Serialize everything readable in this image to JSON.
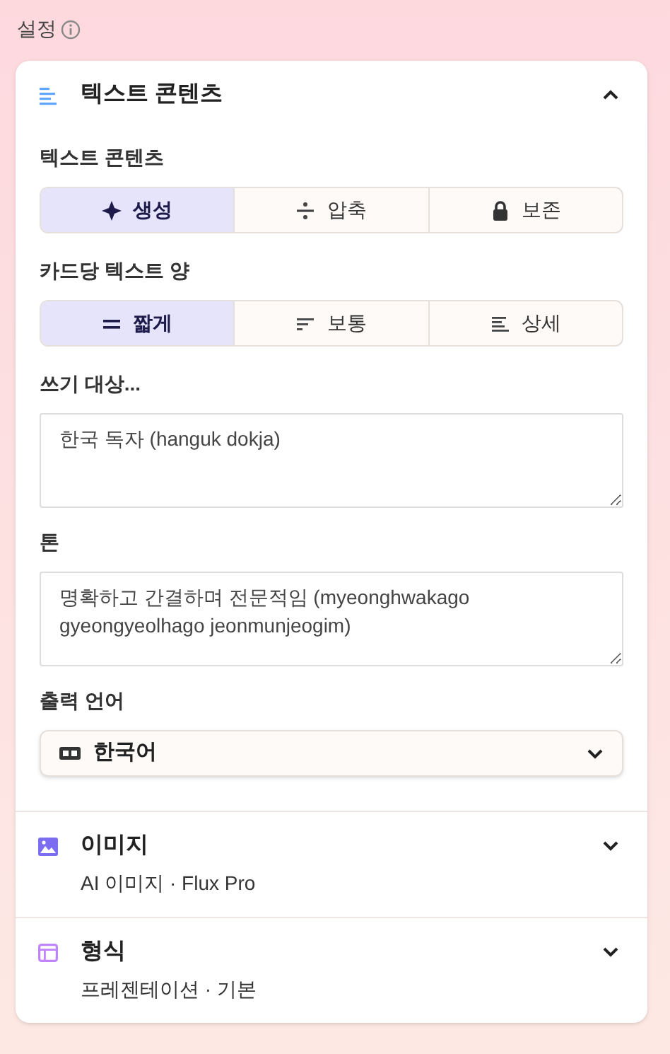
{
  "header": {
    "title": "설정"
  },
  "sections": [
    {
      "kind": "text",
      "title": "텍스트 콘텐츠",
      "expanded": true,
      "fields": [
        {
          "kind": "segmented",
          "label": "텍스트 콘텐츠",
          "options": [
            {
              "label": "생성",
              "selected": true
            },
            {
              "label": "압축",
              "selected": false
            },
            {
              "label": "보존",
              "selected": false
            }
          ]
        },
        {
          "kind": "segmented",
          "label": "카드당 텍스트 양",
          "options": [
            {
              "label": "짧게",
              "selected": true
            },
            {
              "label": "보통",
              "selected": false
            },
            {
              "label": "상세",
              "selected": false
            }
          ]
        },
        {
          "kind": "textarea",
          "label": "쓰기 대상...",
          "value": "한국 독자 (hanguk dokja)"
        },
        {
          "kind": "textarea",
          "label": "톤",
          "value": "명확하고 간결하며 전문적임 (myeonghwakago gyeongyeolhago jeonmunjeogim)"
        },
        {
          "kind": "select",
          "label": "출력 언어",
          "value": "한국어"
        }
      ]
    },
    {
      "kind": "image",
      "title": "이미지",
      "subtitle": "AI 이미지 · Flux Pro",
      "expanded": false
    },
    {
      "kind": "format",
      "title": "형식",
      "subtitle": "프레젠테이션 · 기본",
      "expanded": false
    }
  ]
}
